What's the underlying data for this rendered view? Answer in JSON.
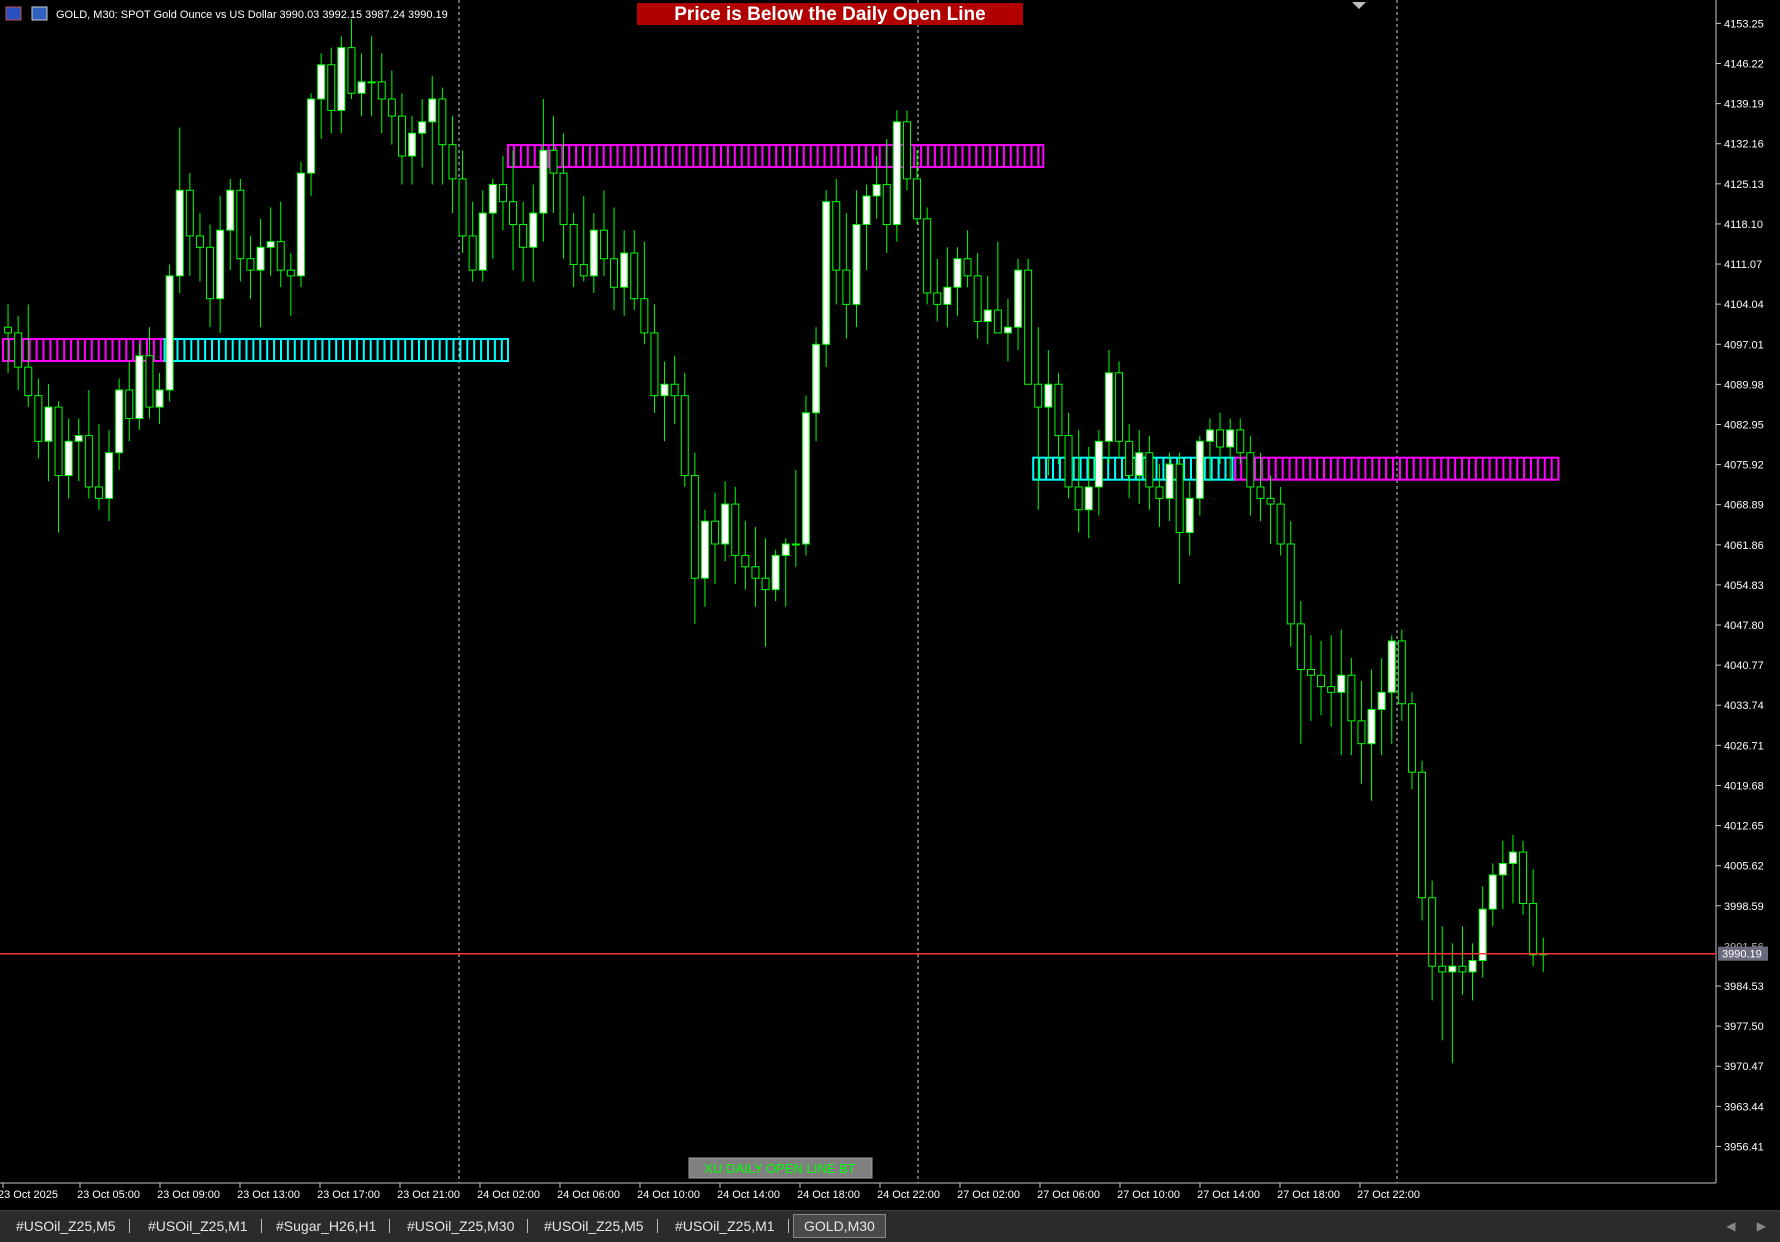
{
  "window": {
    "symbol_info": "GOLD, M30:  SPOT Gold Ounce vs US Dollar  3990.03 3992.15 3987.24 3990.19",
    "banner_text": "Price is Below the Daily Open Line",
    "indicator_label": "XU DAILY OPEN LINE BT",
    "current_price_label": "3990.19",
    "hidden_price_label": "3991.56"
  },
  "colors": {
    "background": "#000000",
    "candle_bull_body": "#ffffff",
    "candle_bear_body": "#000000",
    "candle_outline": "#00ff00",
    "wick": "#00ff00",
    "magenta_band": "#ff00ff",
    "cyan_band": "#00ffff",
    "price_line": "#ff3030",
    "banner_bg": "#b00000",
    "axis_text": "#ffffff",
    "indicator_label_text": "#00ff00",
    "indicator_label_bg": "#808080"
  },
  "icons": [
    "bars-icon",
    "chart-window-icon"
  ],
  "y_axis_labels": [
    "4153.25",
    "4146.22",
    "4139.19",
    "4132.16",
    "4125.13",
    "4118.10",
    "4111.07",
    "4104.04",
    "4097.01",
    "4089.98",
    "4082.95",
    "4075.92",
    "4068.89",
    "4061.86",
    "4054.83",
    "4047.80",
    "4040.77",
    "4033.74",
    "4026.71",
    "4019.68",
    "4012.65",
    "4005.62",
    "3998.59",
    "3984.53",
    "3977.50",
    "3970.47",
    "3963.44",
    "3956.41"
  ],
  "x_axis_labels": [
    "23 Oct 2025",
    "23 Oct 05:00",
    "23 Oct 09:00",
    "23 Oct 13:00",
    "23 Oct 17:00",
    "23 Oct 21:00",
    "24 Oct 02:00",
    "24 Oct 06:00",
    "24 Oct 10:00",
    "24 Oct 14:00",
    "24 Oct 18:00",
    "24 Oct 22:00",
    "27 Oct 02:00",
    "27 Oct 06:00",
    "27 Oct 10:00",
    "27 Oct 14:00",
    "27 Oct 18:00",
    "27 Oct 22:00"
  ],
  "tabs": [
    {
      "label": "#USOil_Z25,M5",
      "active": false
    },
    {
      "label": "#USOil_Z25,M1",
      "active": false
    },
    {
      "label": "#Sugar_H26,H1",
      "active": false
    },
    {
      "label": "#USOil_Z25,M30",
      "active": false
    },
    {
      "label": "#USOil_Z25,M5",
      "active": false
    },
    {
      "label": "#USOil_Z25,M1",
      "active": false
    },
    {
      "label": "GOLD,M30",
      "active": true
    }
  ],
  "chart_data": {
    "type": "candlestick",
    "symbol": "GOLD",
    "timeframe": "M30",
    "ylim": [
      3950,
      4157
    ],
    "current_price": 3990.19,
    "day_separators": [
      "23 Oct 21:00",
      "24 Oct 22:00",
      "27 Oct 22:00"
    ],
    "daily_open_bands": [
      {
        "day": "23 Oct",
        "level": 4096.0,
        "color": "magenta",
        "from_bar": 0,
        "to_bar": 16
      },
      {
        "day": "23 Oct",
        "level": 4096.0,
        "color": "cyan",
        "from_bar": 16,
        "to_bar": 50
      },
      {
        "day": "24 Oct",
        "level": 4130.0,
        "color": "magenta",
        "from_bar": 50,
        "to_bar": 103
      },
      {
        "day": "27 Oct",
        "level": 4075.2,
        "color": "cyan",
        "from_bar": 102,
        "to_bar": 122
      },
      {
        "day": "27 Oct",
        "level": 4075.2,
        "color": "magenta",
        "from_bar": 122,
        "to_bar": 154
      }
    ],
    "candles": [
      [
        4100.0,
        4104.0,
        4092.0,
        4099.0
      ],
      [
        4099.0,
        4102.0,
        4089.0,
        4093.0
      ],
      [
        4093.0,
        4104.0,
        4086.0,
        4088.0
      ],
      [
        4088.0,
        4091.0,
        4077.0,
        4080.0
      ],
      [
        4080.0,
        4090.0,
        4073.0,
        4086.0
      ],
      [
        4086.0,
        4087.0,
        4064.0,
        4074.0
      ],
      [
        4074.0,
        4084.0,
        4070.0,
        4080.0
      ],
      [
        4080.0,
        4084.0,
        4073.0,
        4081.0
      ],
      [
        4081.0,
        4089.0,
        4070.0,
        4072.0
      ],
      [
        4072.0,
        4083.0,
        4068.0,
        4070.0
      ],
      [
        4070.0,
        4082.0,
        4066.0,
        4078.0
      ],
      [
        4078.0,
        4091.0,
        4075.0,
        4089.0
      ],
      [
        4089.0,
        4094.0,
        4080.0,
        4084.0
      ],
      [
        4084.0,
        4097.0,
        4082.0,
        4095.0
      ],
      [
        4095.0,
        4100.0,
        4084.0,
        4086.0
      ],
      [
        4086.0,
        4092.0,
        4083.0,
        4089.0
      ],
      [
        4089.0,
        4111.0,
        4087.0,
        4109.0
      ],
      [
        4109.0,
        4135.0,
        4106.0,
        4124.0
      ],
      [
        4124.0,
        4127.0,
        4109.0,
        4116.0
      ],
      [
        4116.0,
        4120.0,
        4108.0,
        4114.0
      ],
      [
        4114.0,
        4118.0,
        4100.0,
        4105.0
      ],
      [
        4105.0,
        4123.0,
        4099.0,
        4117.0
      ],
      [
        4117.0,
        4126.0,
        4110.0,
        4124.0
      ],
      [
        4124.0,
        4126.0,
        4108.0,
        4112.0
      ],
      [
        4112.0,
        4116.0,
        4105.0,
        4110.0
      ],
      [
        4110.0,
        4119.0,
        4100.0,
        4114.0
      ],
      [
        4114.0,
        4121.0,
        4109.0,
        4115.0
      ],
      [
        4115.0,
        4122.0,
        4107.0,
        4110.0
      ],
      [
        4110.0,
        4113.0,
        4102.0,
        4109.0
      ],
      [
        4109.0,
        4129.0,
        4107.0,
        4127.0
      ],
      [
        4127.0,
        4141.0,
        4123.0,
        4140.0
      ],
      [
        4140.0,
        4148.0,
        4133.0,
        4146.0
      ],
      [
        4146.0,
        4149.0,
        4134.0,
        4138.0
      ],
      [
        4138.0,
        4151.0,
        4134.0,
        4149.0
      ],
      [
        4149.0,
        4154.0,
        4140.0,
        4141.0
      ],
      [
        4141.0,
        4148.0,
        4137.0,
        4143.0
      ],
      [
        4143.0,
        4151.0,
        4137.0,
        4143.0
      ],
      [
        4143.0,
        4148.0,
        4134.0,
        4140.0
      ],
      [
        4140.0,
        4145.0,
        4132.0,
        4137.0
      ],
      [
        4137.0,
        4141.0,
        4125.0,
        4130.0
      ],
      [
        4130.0,
        4137.0,
        4125.0,
        4134.0
      ],
      [
        4134.0,
        4140.0,
        4128.0,
        4136.0
      ],
      [
        4136.0,
        4144.0,
        4125.0,
        4140.0
      ],
      [
        4140.0,
        4142.0,
        4125.0,
        4132.0
      ],
      [
        4132.0,
        4137.0,
        4120.0,
        4126.0
      ],
      [
        4126.0,
        4131.0,
        4113.0,
        4116.0
      ],
      [
        4116.0,
        4122.0,
        4108.0,
        4110.0
      ],
      [
        4110.0,
        4124.0,
        4108.0,
        4120.0
      ],
      [
        4120.0,
        4126.0,
        4112.0,
        4125.0
      ],
      [
        4125.0,
        4130.0,
        4117.0,
        4122.0
      ],
      [
        4122.0,
        4131.0,
        4110.0,
        4118.0
      ],
      [
        4118.0,
        4122.0,
        4108.0,
        4114.0
      ],
      [
        4114.0,
        4125.0,
        4108.0,
        4120.0
      ],
      [
        4120.0,
        4140.0,
        4115.0,
        4131.0
      ],
      [
        4131.0,
        4137.0,
        4120.0,
        4127.0
      ],
      [
        4127.0,
        4134.0,
        4112.0,
        4118.0
      ],
      [
        4118.0,
        4120.0,
        4107.0,
        4111.0
      ],
      [
        4111.0,
        4123.0,
        4108.0,
        4109.0
      ],
      [
        4109.0,
        4120.0,
        4106.0,
        4117.0
      ],
      [
        4117.0,
        4124.0,
        4109.0,
        4112.0
      ],
      [
        4112.0,
        4121.0,
        4103.0,
        4107.0
      ],
      [
        4107.0,
        4117.0,
        4102.0,
        4113.0
      ],
      [
        4113.0,
        4117.0,
        4103.0,
        4105.0
      ],
      [
        4105.0,
        4115.0,
        4097.0,
        4099.0
      ],
      [
        4099.0,
        4104.0,
        4085.0,
        4088.0
      ],
      [
        4088.0,
        4094.0,
        4080.0,
        4090.0
      ],
      [
        4090.0,
        4095.0,
        4083.0,
        4088.0
      ],
      [
        4088.0,
        4092.0,
        4072.0,
        4074.0
      ],
      [
        4074.0,
        4078.0,
        4048.0,
        4056.0
      ],
      [
        4056.0,
        4068.0,
        4051.0,
        4066.0
      ],
      [
        4066.0,
        4071.0,
        4055.0,
        4062.0
      ],
      [
        4062.0,
        4073.0,
        4059.0,
        4069.0
      ],
      [
        4069.0,
        4072.0,
        4055.0,
        4060.0
      ],
      [
        4060.0,
        4066.0,
        4054.0,
        4058.0
      ],
      [
        4058.0,
        4065.0,
        4051.0,
        4056.0
      ],
      [
        4056.0,
        4063.0,
        4044.0,
        4054.0
      ],
      [
        4054.0,
        4061.0,
        4052.0,
        4060.0
      ],
      [
        4060.0,
        4063.0,
        4051.0,
        4062.0
      ],
      [
        4062.0,
        4075.0,
        4058.0,
        4062.0
      ],
      [
        4062.0,
        4088.0,
        4060.0,
        4085.0
      ],
      [
        4085.0,
        4100.0,
        4080.0,
        4097.0
      ],
      [
        4097.0,
        4124.0,
        4093.0,
        4122.0
      ],
      [
        4122.0,
        4126.0,
        4104.0,
        4110.0
      ],
      [
        4110.0,
        4120.0,
        4098.0,
        4104.0
      ],
      [
        4104.0,
        4124.0,
        4100.0,
        4118.0
      ],
      [
        4118.0,
        4125.0,
        4110.0,
        4123.0
      ],
      [
        4123.0,
        4130.0,
        4119.0,
        4125.0
      ],
      [
        4125.0,
        4133.0,
        4113.0,
        4118.0
      ],
      [
        4118.0,
        4138.0,
        4115.0,
        4136.0
      ],
      [
        4136.0,
        4138.0,
        4124.0,
        4126.0
      ],
      [
        4126.0,
        4131.0,
        4118.0,
        4119.0
      ],
      [
        4119.0,
        4121.0,
        4104.0,
        4106.0
      ],
      [
        4106.0,
        4112.0,
        4101.0,
        4104.0
      ],
      [
        4104.0,
        4114.0,
        4100.0,
        4107.0
      ],
      [
        4107.0,
        4114.0,
        4102.0,
        4112.0
      ],
      [
        4112.0,
        4117.0,
        4107.0,
        4109.0
      ],
      [
        4109.0,
        4113.0,
        4098.0,
        4101.0
      ],
      [
        4101.0,
        4109.0,
        4097.0,
        4103.0
      ],
      [
        4103.0,
        4115.0,
        4100.0,
        4099.0
      ],
      [
        4099.0,
        4105.0,
        4094.0,
        4100.0
      ],
      [
        4100.0,
        4112.0,
        4096.0,
        4110.0
      ],
      [
        4110.0,
        4112.0,
        4095.0,
        4090.0
      ],
      [
        4090.0,
        4100.0,
        4068.0,
        4086.0
      ],
      [
        4086.0,
        4096.0,
        4074.0,
        4090.0
      ],
      [
        4090.0,
        4092.0,
        4076.0,
        4081.0
      ],
      [
        4081.0,
        4085.0,
        4070.0,
        4072.0
      ],
      [
        4072.0,
        4082.0,
        4064.0,
        4068.0
      ],
      [
        4068.0,
        4079.0,
        4063.0,
        4072.0
      ],
      [
        4072.0,
        4082.0,
        4067.0,
        4080.0
      ],
      [
        4080.0,
        4096.0,
        4076.0,
        4092.0
      ],
      [
        4092.0,
        4094.0,
        4077.0,
        4080.0
      ],
      [
        4080.0,
        4083.0,
        4070.0,
        4074.0
      ],
      [
        4074.0,
        4082.0,
        4069.0,
        4078.0
      ],
      [
        4078.0,
        4081.0,
        4068.0,
        4072.0
      ],
      [
        4072.0,
        4076.0,
        4065.0,
        4070.0
      ],
      [
        4070.0,
        4078.0,
        4066.0,
        4076.0
      ],
      [
        4076.0,
        4078.0,
        4055.0,
        4064.0
      ],
      [
        4064.0,
        4073.0,
        4060.0,
        4070.0
      ],
      [
        4070.0,
        4081.0,
        4067.0,
        4080.0
      ],
      [
        4080.0,
        4084.0,
        4073.0,
        4082.0
      ],
      [
        4082.0,
        4085.0,
        4076.0,
        4079.0
      ],
      [
        4079.0,
        4084.0,
        4073.0,
        4082.0
      ],
      [
        4082.0,
        4084.0,
        4076.0,
        4078.0
      ],
      [
        4078.0,
        4081.0,
        4067.0,
        4072.0
      ],
      [
        4072.0,
        4078.0,
        4066.0,
        4070.0
      ],
      [
        4070.0,
        4074.0,
        4062.0,
        4069.0
      ],
      [
        4069.0,
        4072.0,
        4060.0,
        4062.0
      ],
      [
        4062.0,
        4066.0,
        4044.0,
        4048.0
      ],
      [
        4048.0,
        4052.0,
        4027.0,
        4040.0
      ],
      [
        4040.0,
        4046.0,
        4031.0,
        4039.0
      ],
      [
        4039.0,
        4045.0,
        4032.0,
        4037.0
      ],
      [
        4037.0,
        4046.0,
        4030.0,
        4036.0
      ],
      [
        4036.0,
        4047.0,
        4025.0,
        4039.0
      ],
      [
        4039.0,
        4042.0,
        4025.0,
        4031.0
      ],
      [
        4031.0,
        4038.0,
        4020.0,
        4027.0
      ],
      [
        4027.0,
        4040.0,
        4017.0,
        4033.0
      ],
      [
        4033.0,
        4042.0,
        4025.0,
        4036.0
      ],
      [
        4036.0,
        4046.0,
        4027.0,
        4045.0
      ],
      [
        4045.0,
        4047.0,
        4031.0,
        4034.0
      ],
      [
        4034.0,
        4036.0,
        4019.0,
        4022.0
      ],
      [
        4022.0,
        4024.0,
        3996.0,
        4000.0
      ],
      [
        4000.0,
        4003.0,
        3982.0,
        3988.0
      ],
      [
        3988.0,
        3995.0,
        3975.0,
        3987.0
      ],
      [
        3987.0,
        3992.0,
        3971.0,
        3988.0
      ],
      [
        3988.0,
        3995.0,
        3983.0,
        3987.0
      ],
      [
        3987.0,
        3992.0,
        3982.0,
        3989.0
      ],
      [
        3989.0,
        4002.0,
        3986.0,
        3998.0
      ],
      [
        3998.0,
        4006.0,
        3995.0,
        4004.0
      ],
      [
        4004.0,
        4010.0,
        3998.0,
        4006.0
      ],
      [
        4006.0,
        4011.0,
        3999.0,
        4008.0
      ],
      [
        4008.0,
        4010.0,
        3997.0,
        3999.0
      ],
      [
        3999.0,
        4005.0,
        3988.0,
        3990.0
      ],
      [
        3990.0,
        3993.0,
        3987.0,
        3990.19
      ]
    ]
  }
}
